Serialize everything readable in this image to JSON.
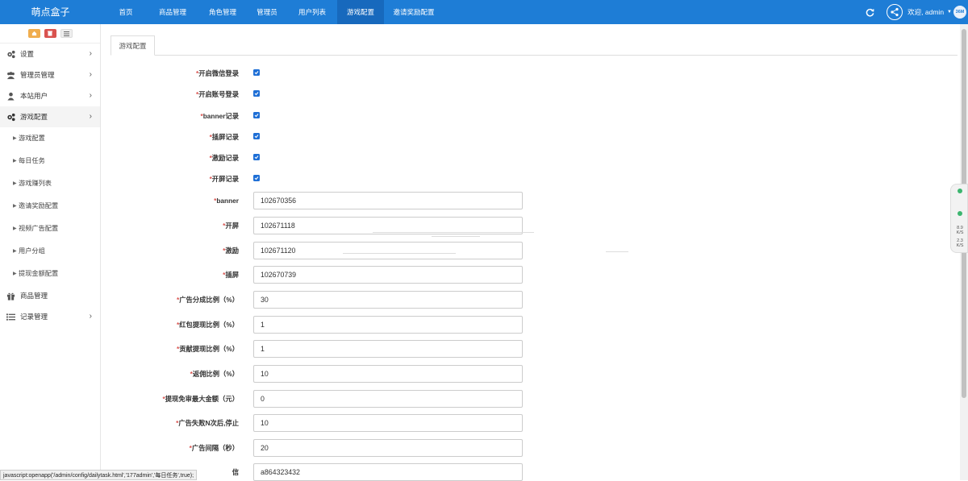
{
  "brand": "萌点盒子",
  "nav": [
    {
      "label": "首页",
      "active": false
    },
    {
      "label": "商品管理",
      "active": false
    },
    {
      "label": "角色管理",
      "active": false
    },
    {
      "label": "管理员",
      "active": false
    },
    {
      "label": "用户列表",
      "active": false
    },
    {
      "label": "游戏配置",
      "active": true
    },
    {
      "label": "邀请奖励配置",
      "active": false
    }
  ],
  "header_right": {
    "welcome": "欢迎, admin",
    "avatar_text": "36M"
  },
  "sidebar": {
    "menu": [
      {
        "label": "设置",
        "icon": "gears-icon",
        "has_arrow": true
      },
      {
        "label": "管理员管理",
        "icon": "users-icon",
        "has_arrow": true
      },
      {
        "label": "本站用户",
        "icon": "user-icon",
        "has_arrow": true
      },
      {
        "label": "游戏配置",
        "icon": "gears-icon",
        "has_arrow": true,
        "active": true
      }
    ],
    "sub": [
      "游戏配置",
      "每日任务",
      "游戏赚列表",
      "邀请奖励配置",
      "视频广告配置",
      "用户分组",
      "提现金额配置"
    ],
    "menu_after": [
      {
        "label": "商品管理",
        "icon": "gift-icon",
        "has_arrow": false
      },
      {
        "label": "记录管理",
        "icon": "list-icon",
        "has_arrow": true
      }
    ]
  },
  "tab": "游戏配置",
  "form": {
    "checkboxes": [
      {
        "label": "开启微信登录",
        "checked": true
      },
      {
        "label": "开启账号登录",
        "checked": true
      },
      {
        "label": "banner记录",
        "checked": true
      },
      {
        "label": "插屏记录",
        "checked": true
      },
      {
        "label": "激励记录",
        "checked": true
      },
      {
        "label": "开屏记录",
        "checked": true
      }
    ],
    "inputs": [
      {
        "label": "banner",
        "value": "102670356"
      },
      {
        "label": "开屏",
        "value": "102671118"
      },
      {
        "label": "激励",
        "value": "102671120"
      },
      {
        "label": "插屏",
        "value": "102670739"
      },
      {
        "label": "广告分成比例（%）",
        "value": "30"
      },
      {
        "label": "红包提现比例（%）",
        "value": "1"
      },
      {
        "label": "贡献提现比例（%）",
        "value": "1"
      },
      {
        "label": "返佣比例（%）",
        "value": "10"
      },
      {
        "label": "提现免审最大金额（元）",
        "value": "0"
      },
      {
        "label": "广告失败N次后,停止",
        "value": "10"
      },
      {
        "label": "广告间隔（秒）",
        "value": "20"
      },
      {
        "label": "信",
        "value": "a864323432"
      }
    ],
    "required_mark": "*"
  },
  "widget": {
    "n1": "8.9",
    "n1_unit": "K/S",
    "n2": "2.3",
    "n2_unit": "K/S"
  },
  "statusbar": "javascript:openapp('/admin/config/dailytask.html','177admin','每日任务',true);",
  "colors": {
    "topbar": "#1e7dd6",
    "required": "#d9534f",
    "checkbox": "#1e6fd6"
  }
}
